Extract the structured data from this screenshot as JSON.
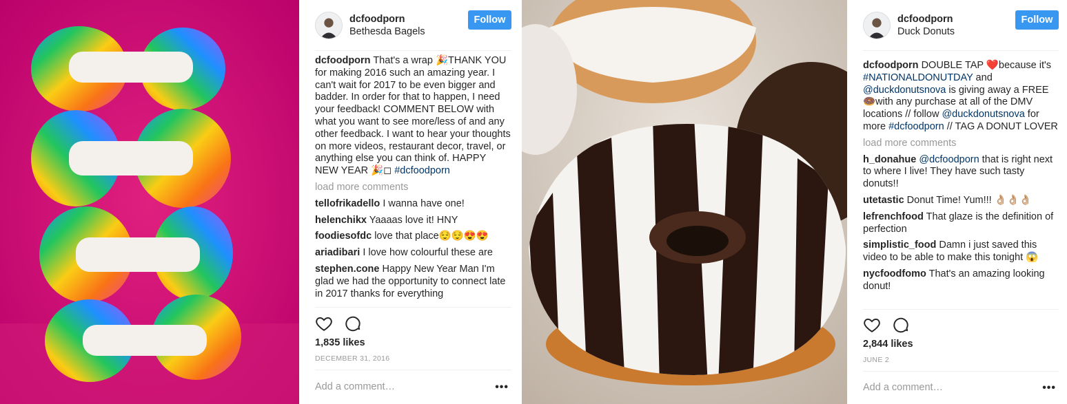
{
  "posts": [
    {
      "username": "dcfoodporn",
      "location": "Bethesda Bagels",
      "follow_label": "Follow",
      "caption": {
        "user": "dcfoodporn",
        "text": "That's a wrap 🎉THANK YOU for making 2016 such an amazing year. I can't wait for 2017 to be even bigger and badder. In order for that to happen, I need your feedback! COMMENT BELOW with what you want to see more/less of and any other feedback. I want to hear your thoughts on more videos, restaurant decor, travel, or anything else you can think of. HAPPY NEW YEAR 🎉◻",
        "hashtag": "#dcfoodporn"
      },
      "load_more": "load more comments",
      "comments": [
        {
          "user": "tellofrikadello",
          "text": "I wanna have one!"
        },
        {
          "user": "helenchikx",
          "text": "Yaaaas love it! HNY"
        },
        {
          "user": "foodiesofdc",
          "text": "love that place😌😌😍😍"
        },
        {
          "user": "ariadibari",
          "text": "I love how colourful these are"
        },
        {
          "user": "stephen.cone",
          "text": "Happy New Year Man I'm glad we had the opportunity to connect late in 2017 thanks for everything"
        }
      ],
      "likes": "1,835 likes",
      "date": "DECEMBER 31, 2016",
      "add_comment_placeholder": "Add a comment…",
      "more_label": "•••"
    },
    {
      "username": "dcfoodporn",
      "location": "Duck Donuts",
      "follow_label": "Follow",
      "caption": {
        "user": "dcfoodporn",
        "pre": "DOUBLE TAP ❤️because it's ",
        "tag1": "#NATIONALDONUTDAY",
        "mid1": " and ",
        "tag2": "@duckdonutsnova",
        "mid2": " is giving away a FREE 🍩with any purchase at all of the DMV locations // follow ",
        "tag3": "@duckdonutsnova",
        "mid3": " for more ",
        "tag4": "#dcfoodporn",
        "post": " // TAG A DONUT LOVER"
      },
      "load_more": "load more comments",
      "comments": [
        {
          "user": "h_donahue",
          "mention": "@dcfoodporn",
          "text": " that is right next to where I live! They have such tasty donuts!!"
        },
        {
          "user": "utetastic",
          "text": "Donut Time! Yum!!! 👌🏼👌🏼👌🏼"
        },
        {
          "user": "lefrenchfood",
          "text": "That glaze is the definition of perfection"
        },
        {
          "user": "simplistic_food",
          "text": "Damn i just saved this video to be able to make this tonight 😱"
        },
        {
          "user": "nycfoodfomo",
          "text": "That's an amazing looking donut!"
        }
      ],
      "likes": "2,844 likes",
      "date": "JUNE 2",
      "add_comment_placeholder": "Add a comment…",
      "more_label": "•••"
    }
  ],
  "icons": [
    "heart-icon",
    "comment-icon",
    "avatar"
  ],
  "colors": {
    "follow": "#3897f0",
    "link": "#003569",
    "muted": "#999999"
  }
}
